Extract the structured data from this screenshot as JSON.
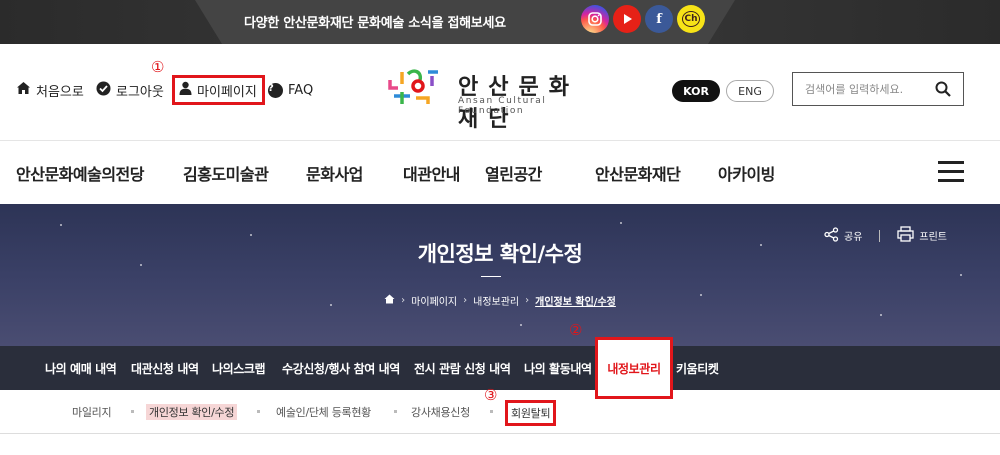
{
  "banner": {
    "message": "다양한 안산문화재단 문화예술 소식을 접해보세요",
    "sns": [
      "instagram-icon",
      "youtube-icon",
      "facebook-icon",
      "kakao-channel-icon"
    ],
    "facebook_glyph": "f",
    "kakao_glyph": "Ch"
  },
  "utility": {
    "home": "처음으로",
    "logout": "로그아웃",
    "mypage": "마이페이지",
    "faq": "FAQ"
  },
  "annotations": [
    "①",
    "②",
    "③"
  ],
  "logo": {
    "kr": "안산문화재단",
    "en": "Ansan Cultural Foundation"
  },
  "lang": {
    "kor": "KOR",
    "eng": "ENG"
  },
  "search": {
    "placeholder": "검색어를 입력하세요."
  },
  "gnb": [
    "안산문화예술의전당",
    "김홍도미술관",
    "문화사업",
    "대관안내",
    "열린공간",
    "안산문화재단",
    "아카이빙"
  ],
  "hero": {
    "title": "개인정보 확인/수정",
    "share": "공유",
    "print": "프린트",
    "breadcrumb": [
      "마이페이지",
      "내정보관리",
      "개인정보 확인/수정"
    ]
  },
  "subnav": {
    "items": [
      "나의 예매 내역",
      "대관신청 내역",
      "나의스크랩",
      "수강신청/행사 참여 내역",
      "전시 관람 신청 내역",
      "나의 활동내역",
      "내정보관리",
      "키움티켓"
    ],
    "active": "내정보관리"
  },
  "tabs3": {
    "items": [
      "마일리지",
      "개인정보 확인/수정",
      "예술인/단체 등록현황",
      "강사채용신청",
      "회원탈퇴"
    ],
    "active": "개인정보 확인/수정"
  },
  "colors": {
    "highlight_red": "#e1161b",
    "dark_nav": "#2a2e3b"
  }
}
